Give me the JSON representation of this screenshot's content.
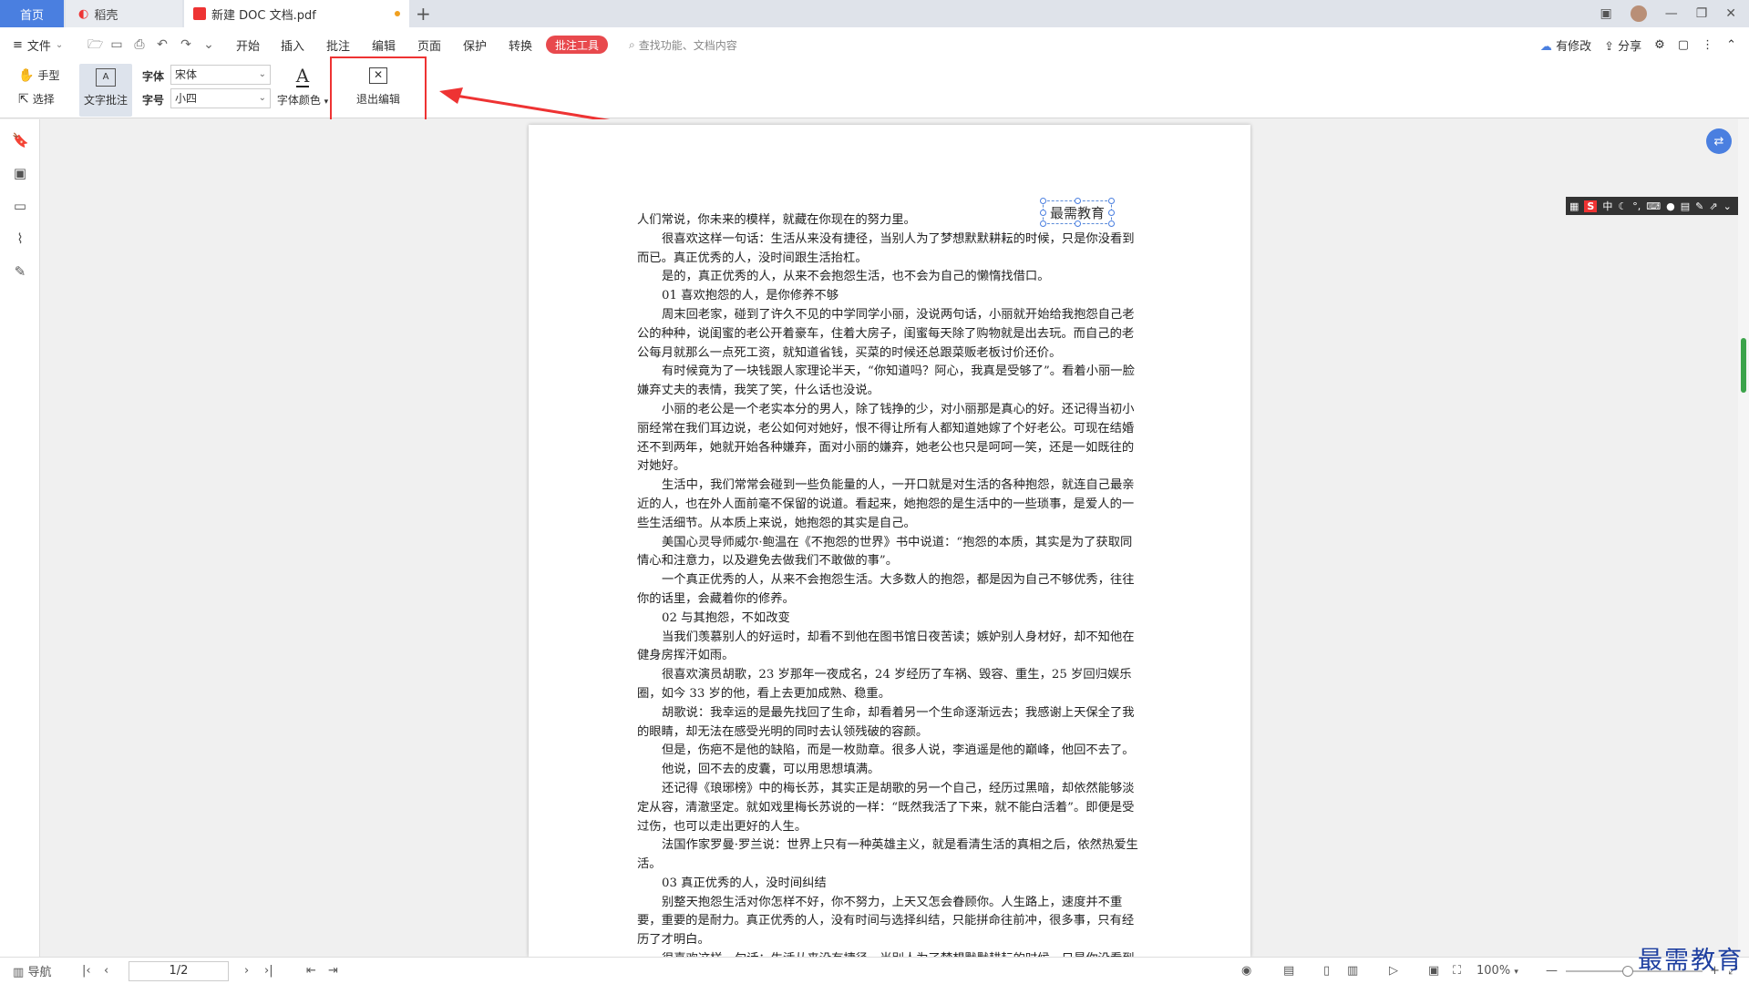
{
  "tabs": {
    "home": "首页",
    "daoke": "稻壳",
    "pdf": "新建 DOC 文档.pdf"
  },
  "menu": {
    "file": "文件",
    "items": [
      "开始",
      "插入",
      "批注",
      "编辑",
      "页面",
      "保护",
      "转换"
    ],
    "active_tool": "批注工具",
    "search_placeholder": "查找功能、文档内容",
    "has_changes": "有修改",
    "share": "分享"
  },
  "ribbon": {
    "hand": "手型",
    "select": "选择",
    "text_annotation": "文字批注",
    "font_label": "字体",
    "font_value": "宋体",
    "size_label": "字号",
    "size_value": "小四",
    "font_color": "字体颜色",
    "exit_edit": "退出编辑"
  },
  "annotation_text": "最需教育",
  "document": {
    "paragraphs": [
      {
        "indent": false,
        "text": "人们常说，你未来的模样，就藏在你现在的努力里。"
      },
      {
        "indent": true,
        "text": "很喜欢这样一句话：生活从来没有捷径，当别人为了梦想默默耕耘的时候，只是你没看到而已。真正优秀的人，没时间跟生活抬杠。"
      },
      {
        "indent": true,
        "text": "是的，真正优秀的人，从来不会抱怨生活，也不会为自己的懒惰找借口。"
      },
      {
        "indent": true,
        "text": "01 喜欢抱怨的人，是你修养不够"
      },
      {
        "indent": true,
        "text": "周末回老家，碰到了许久不见的中学同学小丽，没说两句话，小丽就开始给我抱怨自己老公的种种，说闺蜜的老公开着豪车，住着大房子，闺蜜每天除了购物就是出去玩。而自己的老公每月就那么一点死工资，就知道省钱，买菜的时候还总跟菜贩老板讨价还价。"
      },
      {
        "indent": true,
        "text": "有时候竟为了一块钱跟人家理论半天，“你知道吗？阿心，我真是受够了”。看着小丽一脸嫌弃丈夫的表情，我笑了笑，什么话也没说。"
      },
      {
        "indent": true,
        "text": "小丽的老公是一个老实本分的男人，除了钱挣的少，对小丽那是真心的好。还记得当初小丽经常在我们耳边说，老公如何对她好，恨不得让所有人都知道她嫁了个好老公。可现在结婚还不到两年，她就开始各种嫌弃，面对小丽的嫌弃，她老公也只是呵呵一笑，还是一如既往的对她好。"
      },
      {
        "indent": true,
        "text": "生活中，我们常常会碰到一些负能量的人，一开口就是对生活的各种抱怨，就连自己最亲近的人，也在外人面前毫不保留的说道。看起来，她抱怨的是生活中的一些琐事，是爱人的一些生活细节。从本质上来说，她抱怨的其实是自己。"
      },
      {
        "indent": true,
        "text": "美国心灵导师威尔·鲍温在《不抱怨的世界》书中说道：“抱怨的本质，其实是为了获取同情心和注意力，以及避免去做我们不敢做的事”。"
      },
      {
        "indent": true,
        "text": "一个真正优秀的人，从来不会抱怨生活。大多数人的抱怨，都是因为自己不够优秀，往往你的话里，会藏着你的修养。"
      },
      {
        "indent": true,
        "text": "02 与其抱怨，不如改变"
      },
      {
        "indent": true,
        "text": "当我们羡慕别人的好运时，却看不到他在图书馆日夜苦读；嫉妒别人身材好，却不知他在健身房挥汗如雨。"
      },
      {
        "indent": true,
        "text": "很喜欢演员胡歌，23 岁那年一夜成名，24 岁经历了车祸、毁容、重生，25 岁回归娱乐圈，如今 33 岁的他，看上去更加成熟、稳重。"
      },
      {
        "indent": true,
        "text": "胡歌说：我幸运的是最先找回了生命，却看着另一个生命逐渐远去；我感谢上天保全了我的眼睛，却无法在感受光明的同时去认领残破的容颜。"
      },
      {
        "indent": true,
        "text": "但是，伤疤不是他的缺陷，而是一枚勋章。很多人说，李逍遥是他的巅峰，他回不去了。"
      },
      {
        "indent": true,
        "text": "他说，回不去的皮囊，可以用思想填满。"
      },
      {
        "indent": true,
        "text": "还记得《琅琊榜》中的梅长苏，其实正是胡歌的另一个自己，经历过黑暗，却依然能够淡定从容，清澈坚定。就如戏里梅长苏说的一样：“既然我活了下来，就不能白活着”。即便是受过伤，也可以走出更好的人生。"
      },
      {
        "indent": true,
        "text": "法国作家罗曼·罗兰说：世界上只有一种英雄主义，就是看清生活的真相之后，依然热爱生活。"
      },
      {
        "indent": true,
        "text": "03 真正优秀的人，没时间纠结"
      },
      {
        "indent": true,
        "text": "别整天抱怨生活对你怎样不好，你不努力，上天又怎会眷顾你。人生路上，速度并不重要，重要的是耐力。真正优秀的人，没有时间与选择纠结，只能拼命往前冲，很多事，只有经历了才明白。"
      },
      {
        "indent": true,
        "text": "很喜欢这样一句话：生活从来没有捷径，当别人为了梦想默默耕耘的时候，只是你没看到而已。"
      }
    ]
  },
  "ime": {
    "badge": "S",
    "label": "中"
  },
  "statusbar": {
    "nav": "导航",
    "page": "1/2",
    "zoom": "100%"
  },
  "watermark": "最需教育",
  "colors": {
    "accent": "#4a7fe0",
    "tool_active": "#e8494d",
    "highlight_box": "#ee3333",
    "watermark": "#1e3fa0"
  }
}
